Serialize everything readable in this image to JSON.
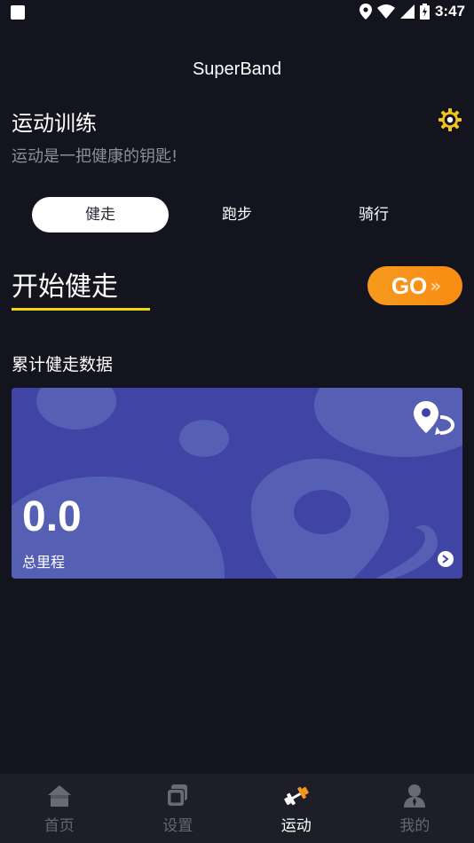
{
  "status_bar": {
    "time": "3:47"
  },
  "app": {
    "title": "SuperBand"
  },
  "header": {
    "title": "运动训练",
    "subtitle": "运动是一把健康的钥匙!"
  },
  "tabs": [
    {
      "label": "健走",
      "active": true
    },
    {
      "label": "跑步",
      "active": false
    },
    {
      "label": "骑行",
      "active": false
    }
  ],
  "start": {
    "label": "开始健走",
    "go_label": "GO",
    "go_arrows": "»"
  },
  "stats": {
    "title": "累计健走数据",
    "value": "0.0",
    "value_label": "总里程"
  },
  "nav": [
    {
      "label": "首页",
      "icon": "home-icon",
      "active": false
    },
    {
      "label": "设置",
      "icon": "settings-icon",
      "active": false
    },
    {
      "label": "运动",
      "icon": "dumbbell-icon",
      "active": true
    },
    {
      "label": "我的",
      "icon": "profile-icon",
      "active": false
    }
  ],
  "colors": {
    "background": "#13141e",
    "accent_go": "#f7941d",
    "underline": "#f2d60c",
    "card": "#3f44a5"
  }
}
